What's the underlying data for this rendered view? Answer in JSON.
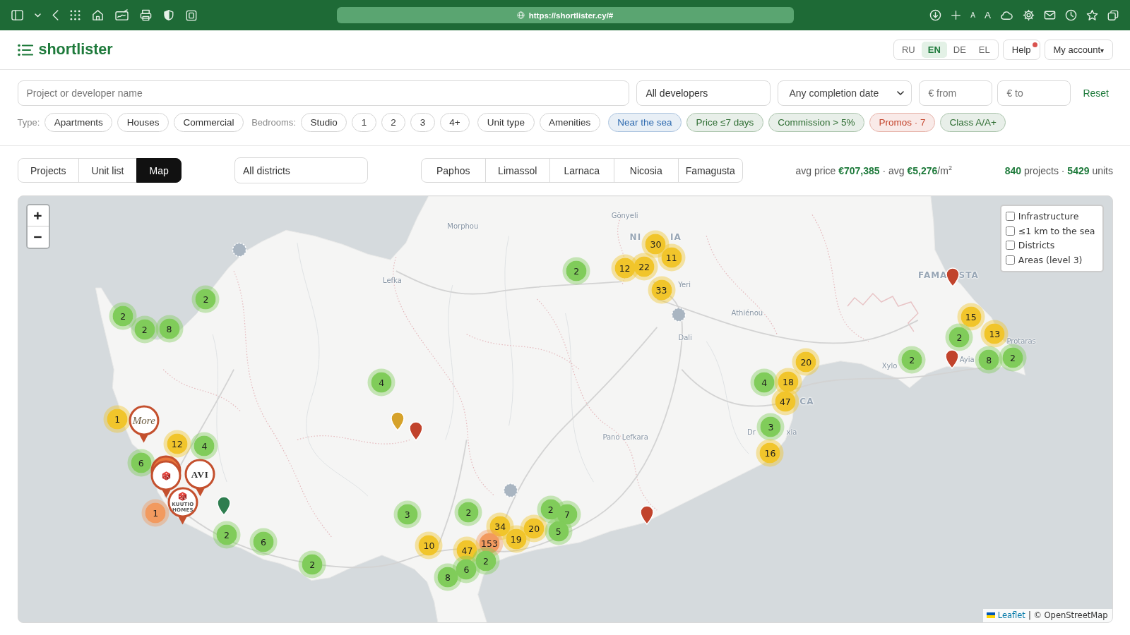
{
  "browser": {
    "url": "https://shortlister.cy/#",
    "text_size_buttons": [
      "A",
      "A"
    ]
  },
  "header": {
    "logo": "shortlister",
    "languages": [
      {
        "code": "RU",
        "selected": false
      },
      {
        "code": "EN",
        "selected": true
      },
      {
        "code": "DE",
        "selected": false
      },
      {
        "code": "EL",
        "selected": false
      }
    ],
    "help": {
      "label": "Help",
      "notification": true
    },
    "account": {
      "label": "My account",
      "caret": "▾"
    }
  },
  "search": {
    "query": {
      "placeholder": "Project or developer name"
    },
    "developer": "All developers",
    "completion": "Any completion date",
    "price_from": {
      "placeholder": "€ from"
    },
    "price_to": {
      "placeholder": "€ to"
    },
    "reset": "Reset"
  },
  "filters": {
    "type_label": "Type:",
    "types": [
      {
        "label": "Apartments",
        "selected": false
      },
      {
        "label": "Houses",
        "selected": false
      },
      {
        "label": "Commercial",
        "selected": false
      }
    ],
    "bedrooms_label": "Bedrooms:",
    "bedrooms": [
      {
        "label": "Studio",
        "selected": false
      },
      {
        "label": "1",
        "selected": false
      },
      {
        "label": "2",
        "selected": false
      },
      {
        "label": "3",
        "selected": false
      },
      {
        "label": "4+",
        "selected": false
      }
    ],
    "more_filters": [
      {
        "label": "Unit type"
      },
      {
        "label": "Amenities"
      }
    ],
    "quick": [
      {
        "label": "Near the sea",
        "color": "#2f6bb0"
      },
      {
        "label": "Price ≤7 days",
        "color": "#2f6e33"
      },
      {
        "label": "Commission > 5%",
        "color": "#2f6e33"
      },
      {
        "label": "Promos · 7",
        "color": "#c4442c"
      },
      {
        "label": "Class A/A+",
        "color": "#2f6e33"
      }
    ]
  },
  "views": {
    "tabs": [
      {
        "label": "Projects",
        "selected": false
      },
      {
        "label": "Unit list",
        "selected": false
      },
      {
        "label": "Map",
        "selected": true
      }
    ],
    "district_select": "All districts",
    "districts": [
      {
        "label": "Paphos",
        "selected": false
      },
      {
        "label": "Limassol",
        "selected": false
      },
      {
        "label": "Larnaca",
        "selected": false
      },
      {
        "label": "Nicosia",
        "selected": false
      },
      {
        "label": "Famagusta",
        "selected": false
      }
    ],
    "averages": "avg price **€707,385** · avg **€5,276**/m$^{2}$",
    "totals": "**840** projects · **5429** units"
  },
  "map": {
    "zoom": {
      "in": "+",
      "out": "−"
    },
    "layers": [
      {
        "label": "Infrastructure",
        "checked": false
      },
      {
        "label": "≤1 km to the sea",
        "checked": false
      },
      {
        "label": "Districts",
        "checked": false
      },
      {
        "label": "Areas (level 3)",
        "checked": false
      }
    ],
    "place_labels": [
      {
        "text": "Gönyeli",
        "kind": "town"
      },
      {
        "text": "Morphou",
        "kind": "town"
      },
      {
        "text": "NI",
        "kind": "city"
      },
      {
        "text": "IA",
        "kind": "city"
      },
      {
        "text": "FAMA",
        "kind": "city"
      },
      {
        "text": "STA",
        "kind": "city"
      },
      {
        "text": "Lefka",
        "kind": "town"
      },
      {
        "text": "Yeri",
        "kind": "town"
      },
      {
        "text": "Athiénou",
        "kind": "town"
      },
      {
        "text": "Dali",
        "kind": "town"
      },
      {
        "text": "Protaras",
        "kind": "town"
      },
      {
        "text": "Ayia",
        "kind": "town"
      },
      {
        "text": "Xylo",
        "kind": "town"
      },
      {
        "text": "CA",
        "kind": "city"
      },
      {
        "text": "Dr",
        "kind": "town"
      },
      {
        "text": "xia",
        "kind": "town"
      },
      {
        "text": "Pano Lefkara",
        "kind": "town"
      }
    ],
    "clusters": [
      {
        "count": "30",
        "color": "#f1c52b"
      },
      {
        "count": "11",
        "color": "#f1c52b"
      },
      {
        "count": "2",
        "color": "#80cc5a"
      },
      {
        "count": "12",
        "color": "#f1c52b"
      },
      {
        "count": "22",
        "color": "#f1c52b"
      },
      {
        "count": "33",
        "color": "#f1c52b"
      },
      {
        "count": "2",
        "color": "#80cc5a"
      },
      {
        "count": "2",
        "color": "#80cc5a"
      },
      {
        "count": "15",
        "color": "#f1c52b"
      },
      {
        "count": "2",
        "color": "#80cc5a"
      },
      {
        "count": "8",
        "color": "#80cc5a"
      },
      {
        "count": "2",
        "color": "#80cc5a"
      },
      {
        "count": "13",
        "color": "#f1c52b"
      },
      {
        "count": "20",
        "color": "#f1c52b"
      },
      {
        "count": "2",
        "color": "#80cc5a"
      },
      {
        "count": "8",
        "color": "#80cc5a"
      },
      {
        "count": "2",
        "color": "#80cc5a"
      },
      {
        "count": "4",
        "color": "#80cc5a"
      },
      {
        "count": "4",
        "color": "#80cc5a"
      },
      {
        "count": "18",
        "color": "#f1c52b"
      },
      {
        "count": "47",
        "color": "#f1c52b"
      },
      {
        "count": "1",
        "color": "#f1c52b"
      },
      {
        "count": "3",
        "color": "#80cc5a"
      },
      {
        "count": "12",
        "color": "#f1c52b"
      },
      {
        "count": "4",
        "color": "#80cc5a"
      },
      {
        "count": "16",
        "color": "#f1c52b"
      },
      {
        "count": "6",
        "color": "#80cc5a"
      },
      {
        "count": "1",
        "color": "#f29a5f"
      },
      {
        "count": "3",
        "color": "#80cc5a"
      },
      {
        "count": "2",
        "color": "#80cc5a"
      },
      {
        "count": "2",
        "color": "#80cc5a"
      },
      {
        "count": "7",
        "color": "#80cc5a"
      },
      {
        "count": "34",
        "color": "#f1c52b"
      },
      {
        "count": "2",
        "color": "#80cc5a"
      },
      {
        "count": "20",
        "color": "#f1c52b"
      },
      {
        "count": "5",
        "color": "#80cc5a"
      },
      {
        "count": "6",
        "color": "#80cc5a"
      },
      {
        "count": "10",
        "color": "#f1c52b"
      },
      {
        "count": "153",
        "color": "#f29a5f"
      },
      {
        "count": "19",
        "color": "#f1c52b"
      },
      {
        "count": "47",
        "color": "#f1c52b"
      },
      {
        "count": "2",
        "color": "#80cc5a"
      },
      {
        "count": "2",
        "color": "#80cc5a"
      },
      {
        "count": "6",
        "color": "#80cc5a"
      },
      {
        "count": "8",
        "color": "#80cc5a"
      }
    ],
    "pins": [
      {
        "color": "#c1432c"
      },
      {
        "color": "#c1432c"
      },
      {
        "color": "#d6a22a"
      },
      {
        "color": "#c1432c"
      },
      {
        "color": "#2e7d4f"
      },
      {
        "color": "#c1432c"
      }
    ],
    "logo_pins": [
      {
        "kind": "script",
        "text": "More",
        "stacked": false
      },
      {
        "kind": "cube",
        "stacked": true
      },
      {
        "kind": "plain",
        "text": "AVI",
        "stacked": false
      },
      {
        "kind": "cube",
        "text": "KUUTIO HOMES",
        "stacked": false
      }
    ],
    "attribution": {
      "link": "Leaflet",
      "text": "| © OpenStreetMap"
    }
  }
}
